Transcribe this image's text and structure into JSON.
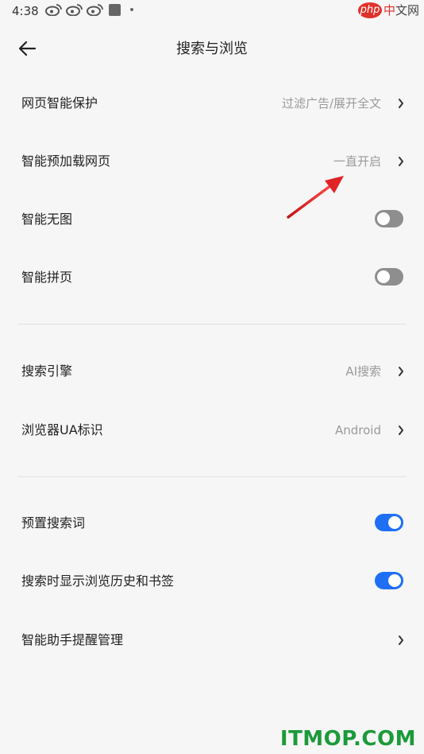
{
  "status_bar": {
    "time": "4:38"
  },
  "watermark_top": {
    "badge": "php",
    "text_red": "中",
    "text_rest": "文网"
  },
  "header": {
    "title": "搜索与浏览"
  },
  "settings": [
    {
      "label": "网页智能保护",
      "value": "过滤广告/展开全文"
    },
    {
      "label": "智能预加载网页",
      "value": "一直开启"
    },
    {
      "label": "智能无图",
      "toggle": false
    },
    {
      "label": "智能拼页",
      "toggle": false
    },
    {
      "label": "搜索引擎",
      "value": "AI搜索"
    },
    {
      "label": "浏览器UA标识",
      "value": "Android"
    },
    {
      "label": "预置搜索词",
      "toggle": true
    },
    {
      "label": "搜索时显示浏览历史和书签",
      "toggle": true
    },
    {
      "label": "智能助手提醒管理"
    }
  ],
  "colors": {
    "accent": "#1f6ff5",
    "toggle_off": "#8e8e8e",
    "annotation_arrow": "#d81e1e"
  },
  "watermark_bottom": {
    "text": "ITMOP.COM"
  }
}
